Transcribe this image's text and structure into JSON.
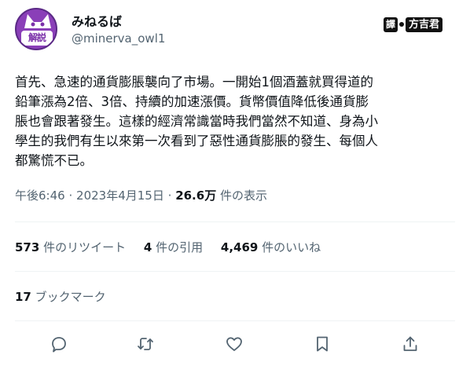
{
  "author": {
    "display_name": "みねるば",
    "handle": "@minerva_owl1",
    "avatar_label": "解説"
  },
  "watermark": {
    "mark": "譯",
    "name": "方吉君"
  },
  "tweet": {
    "text": "首先、急速的通貨膨脹襲向了市場。一開始1個酒蓋就買得道的\n鉛筆漲為2倍、3倍、持續的加速漲價。貨幣價值降低後通貨膨\n脹也會跟著發生。這樣的經濟常識當時我們當然不知道、身為小\n學生的我們有生以來第一次看到了惡性通貨膨脹的發生、每個人\n都驚慌不已。",
    "time": "午後6:46",
    "sep1": "·",
    "date": "2023年4月15日",
    "sep2": "·",
    "views": "26.6万",
    "views_label": "件の表示"
  },
  "stats": {
    "retweets": "573",
    "retweets_label": "件のリツイート",
    "quotes": "4",
    "quotes_label": "件の引用",
    "likes": "4,469",
    "likes_label": "件のいいね",
    "bookmarks": "17",
    "bookmarks_label": "ブックマーク"
  },
  "actions": {
    "reply_icon": "reply-icon",
    "retweet_icon": "retweet-icon",
    "like_icon": "like-icon",
    "bookmark_icon": "bookmark-icon",
    "share_icon": "share-icon"
  },
  "colors": {
    "text": "#0f1419",
    "muted": "#536471",
    "divider": "#eff3f4",
    "avatar": "#8a3fb8"
  }
}
